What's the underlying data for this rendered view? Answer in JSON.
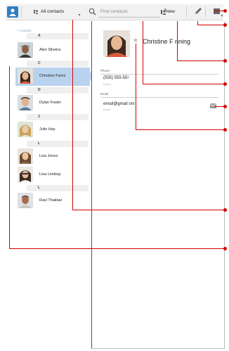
{
  "toolbar": {
    "view_label": "All contacts",
    "search_placeholder": "Find contacts",
    "new_label": "New"
  },
  "list": {
    "count_label": "7 contacts",
    "groups": [
      {
        "letter": "A",
        "contacts": [
          "Alex Silveira"
        ]
      },
      {
        "letter": "C",
        "contacts": [
          "Christine Fanni"
        ]
      },
      {
        "letter": "D",
        "contacts": [
          "Dylan Foster"
        ]
      },
      {
        "letter": "J",
        "contacts": [
          "Julie Hay"
        ]
      },
      {
        "letter": "L",
        "contacts": [
          "Lisa Jones",
          "Lisa Lindsay"
        ]
      },
      {
        "letter": "L",
        "contacts": [
          "Ravi Thakkar"
        ]
      }
    ]
  },
  "detail": {
    "name": "Christine F   nning",
    "phone_label": "Phone",
    "phone_value": "(555) 555-55!",
    "phone_type": "Home",
    "email_label": "Email",
    "email_value": "email@gmail   om",
    "email_type": "Home"
  },
  "colors": {
    "accent": "#2f7fc4",
    "selection": "#b9d3ee",
    "callout": "#d40000"
  }
}
